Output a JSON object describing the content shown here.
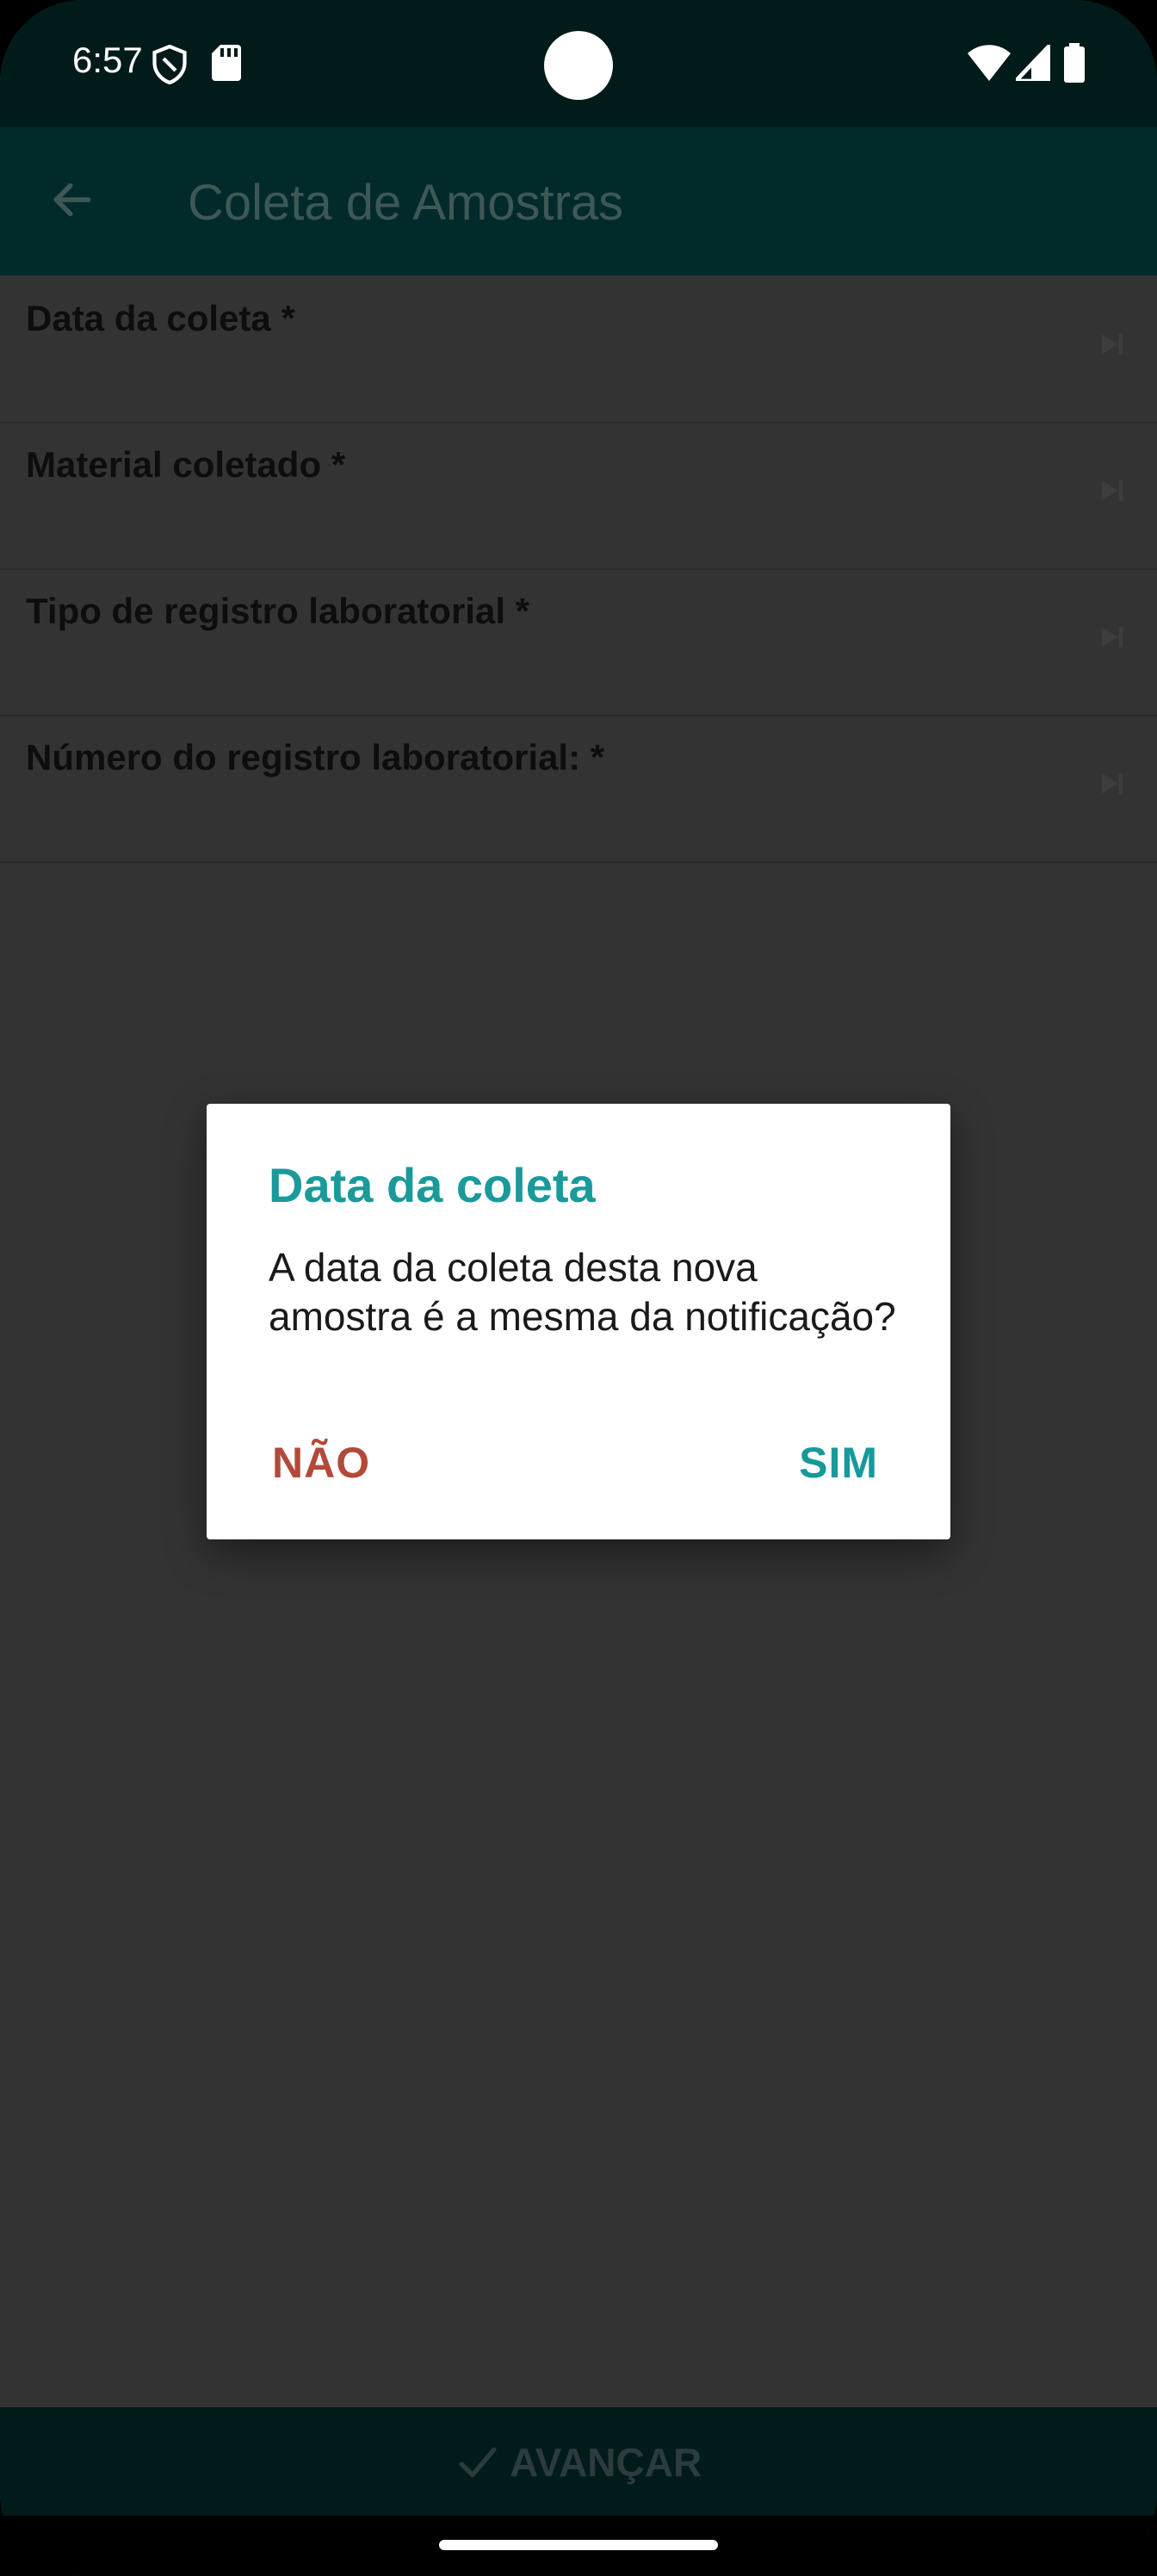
{
  "status_bar": {
    "time": "6:57",
    "icons": [
      "shield-icon",
      "sd-card-icon",
      "wifi-icon",
      "signal-icon",
      "battery-icon"
    ]
  },
  "app_bar": {
    "title": "Coleta de Amostras",
    "back_icon": "arrow-left-icon"
  },
  "form": {
    "items": [
      {
        "label": "Data da coleta *"
      },
      {
        "label": "Material coletado *"
      },
      {
        "label": "Tipo de registro laboratorial *"
      },
      {
        "label": "Número do registro laboratorial: *"
      }
    ]
  },
  "dialog": {
    "title": "Data da coleta",
    "message": "A data da coleta desta nova amostra é a mesma da notificação?",
    "negative_label": "NÃO",
    "positive_label": "SIM"
  },
  "bottom_bar": {
    "advance_label": "AVANÇAR",
    "advance_icon": "check-icon"
  },
  "colors": {
    "accent": "#16999a",
    "negative": "#b24a3b",
    "app_bar": "#022a2a",
    "scrim_background": "#333333"
  }
}
